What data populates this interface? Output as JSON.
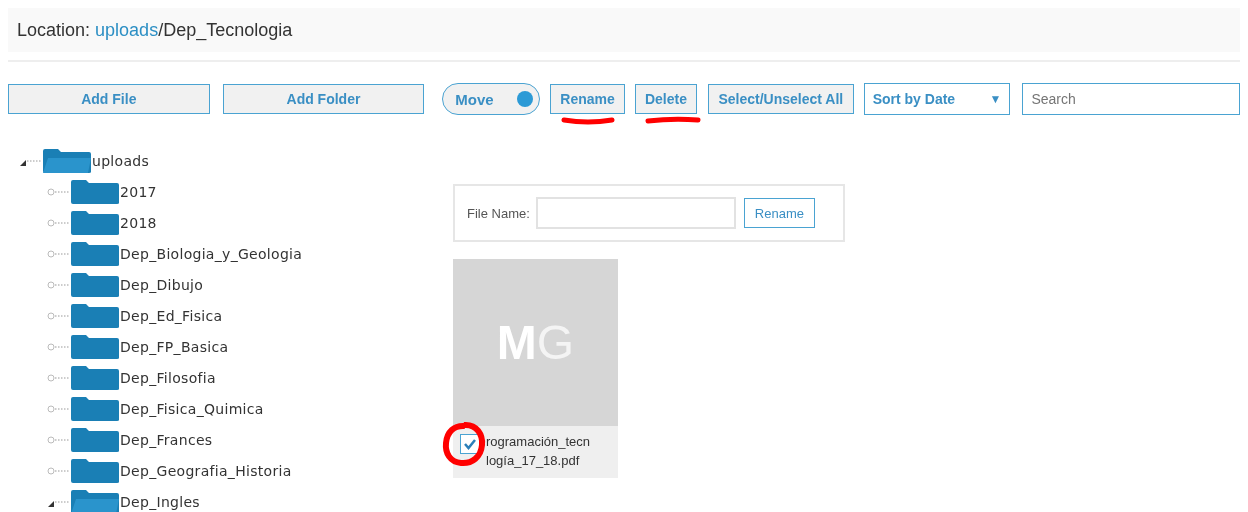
{
  "location": {
    "label": "Location:",
    "path_link": "uploads",
    "path_rest": "/Dep_Tecnologia"
  },
  "toolbar": {
    "add_file": "Add File",
    "add_folder": "Add Folder",
    "move": {
      "label": "Move",
      "on": true
    },
    "rename": {
      "label": "Rename",
      "underlined": true
    },
    "delete": {
      "label": "Delete",
      "underlined": true
    },
    "select_all": "Select/Unselect All",
    "sort": {
      "value": "Sort by Date",
      "caret": "▼"
    },
    "search": {
      "placeholder": "Search"
    }
  },
  "tree": [
    {
      "label": "uploads",
      "expanded": true,
      "children": [
        {
          "label": "2017",
          "expanded": false
        },
        {
          "label": "2018",
          "expanded": false
        },
        {
          "label": "Dep_Biologia_y_Geologia",
          "expanded": false
        },
        {
          "label": "Dep_Dibujo",
          "expanded": false
        },
        {
          "label": "Dep_Ed_Fisica",
          "expanded": false
        },
        {
          "label": "Dep_FP_Basica",
          "expanded": false
        },
        {
          "label": "Dep_Filosofia",
          "expanded": false
        },
        {
          "label": "Dep_Fisica_Quimica",
          "expanded": false
        },
        {
          "label": "Dep_Frances",
          "expanded": false
        },
        {
          "label": "Dep_Geografia_Historia",
          "expanded": false
        },
        {
          "label": "Dep_Ingles",
          "expanded": true
        }
      ]
    }
  ],
  "rename_panel": {
    "label": "File Name:",
    "button": "Rename"
  },
  "files": [
    {
      "thumbnail": [
        "M",
        "G"
      ],
      "name_lines": [
        "rogramación_tecn",
        "logía_17_18.pdf"
      ],
      "checked": true,
      "circled": true
    }
  ]
}
